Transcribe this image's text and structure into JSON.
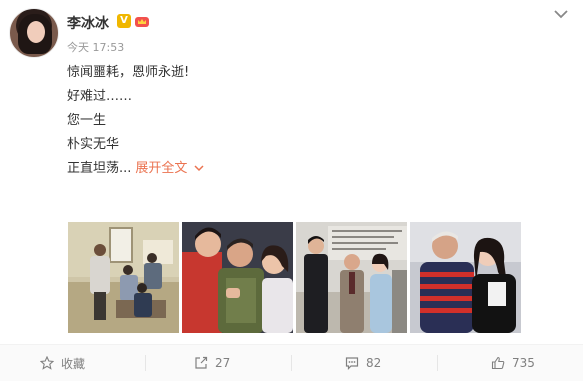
{
  "user": {
    "name": "李冰冰",
    "verified_badge": "V",
    "timestamp": "今天 17:53"
  },
  "post": {
    "lines": [
      "惊闻噩耗，恩师永逝!",
      "好难过……",
      "您一生",
      "朴实无华",
      "正直坦荡..."
    ],
    "expand_label": "展开全文"
  },
  "actions": {
    "favorite_label": "收藏",
    "repost_count": "27",
    "comment_count": "82",
    "like_count": "735"
  },
  "colors": {
    "accent": "#eb7350",
    "verified": "#f0b700",
    "meta_text": "#999999"
  }
}
